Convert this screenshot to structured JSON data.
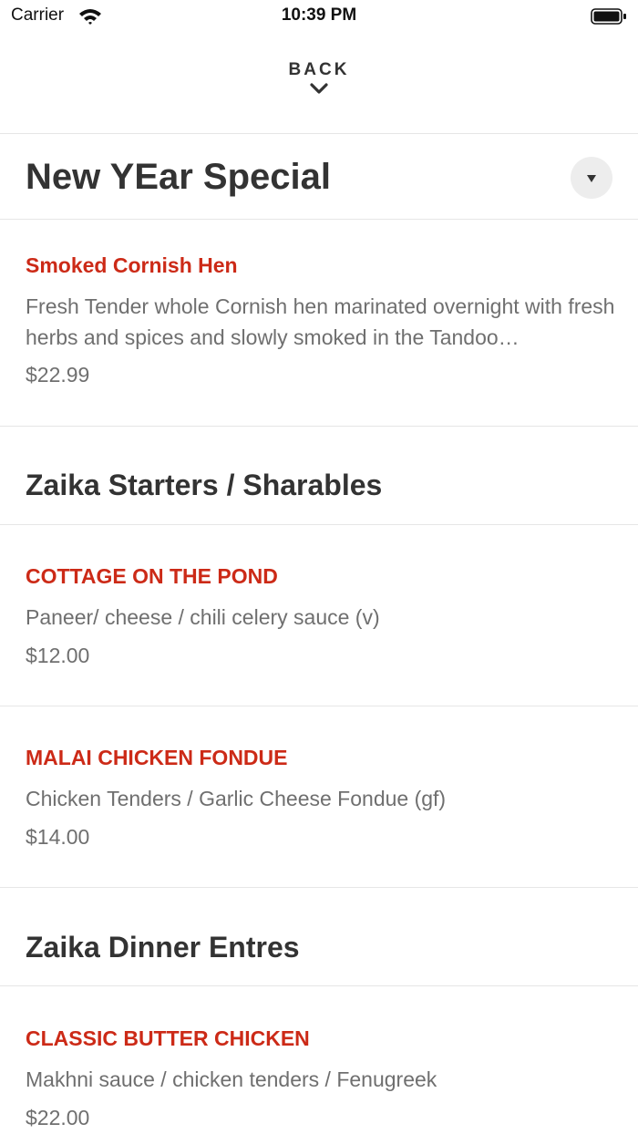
{
  "status_bar": {
    "carrier": "Carrier",
    "time": "10:39 PM",
    "icons": [
      "wifi-icon",
      "battery-icon"
    ]
  },
  "nav": {
    "back_label": "BACK",
    "back_icon": "chevron-down-icon"
  },
  "accent_color": "#cc2a17",
  "special": {
    "title": "New YEar Special",
    "toggle_icon": "dropdown-triangle-icon",
    "items": [
      {
        "name": "Smoked Cornish Hen",
        "description": "Fresh Tender whole Cornish hen marinated overnight with fresh herbs and spices and slowly smoked in the Tandoo…",
        "price": "$22.99"
      }
    ]
  },
  "sections": [
    {
      "title": "Zaika Starters / Sharables",
      "items": [
        {
          "name": "COTTAGE ON THE POND",
          "description": "Paneer/ cheese / chili celery sauce (v)",
          "price": "$12.00"
        },
        {
          "name": "MALAI CHICKEN FONDUE",
          "description": "Chicken Tenders / Garlic Cheese Fondue (gf)",
          "price": "$14.00"
        }
      ]
    },
    {
      "title": "Zaika Dinner Entres",
      "items": [
        {
          "name": "CLASSIC BUTTER CHICKEN",
          "description": "Makhni sauce / chicken tenders / Fenugreek",
          "price": "$22.00"
        }
      ]
    }
  ]
}
